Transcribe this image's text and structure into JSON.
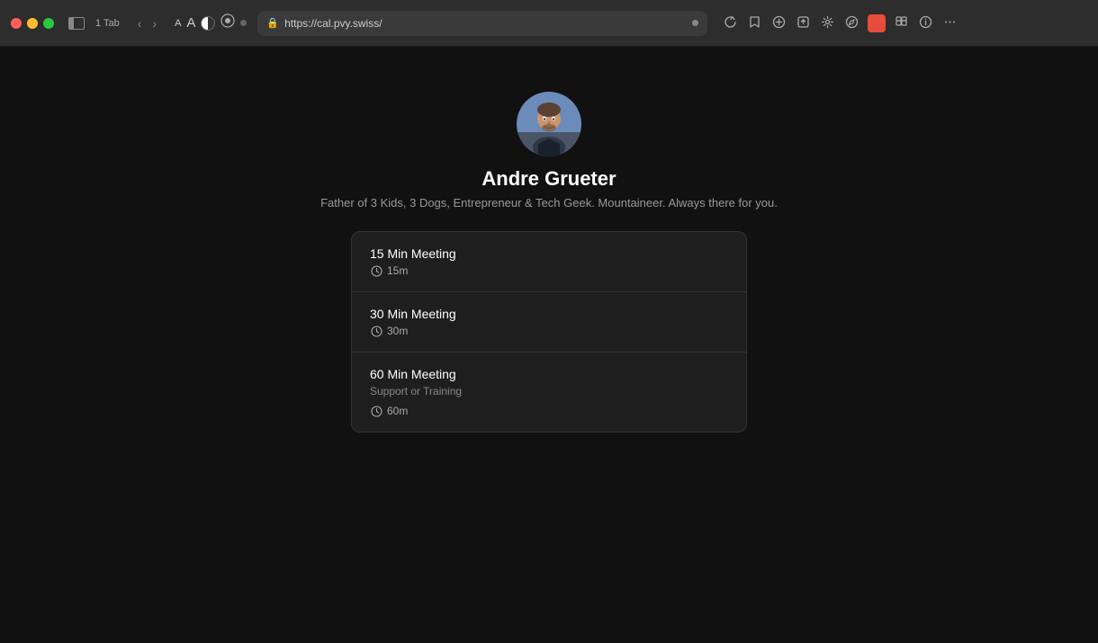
{
  "browser": {
    "tab_count": "1 Tab",
    "url": "https://cal.pvy.swiss/",
    "font_small": "A",
    "font_large": "A"
  },
  "profile": {
    "name": "Andre Grueter",
    "bio": "Father of 3 Kids, 3 Dogs, Entrepreneur & Tech Geek. Mountaineer. Always there for you."
  },
  "meetings": [
    {
      "title": "15 Min Meeting",
      "subtitle": "",
      "duration": "15m"
    },
    {
      "title": "30 Min Meeting",
      "subtitle": "",
      "duration": "30m"
    },
    {
      "title": "60 Min Meeting",
      "subtitle": "Support or Training",
      "duration": "60m"
    }
  ]
}
